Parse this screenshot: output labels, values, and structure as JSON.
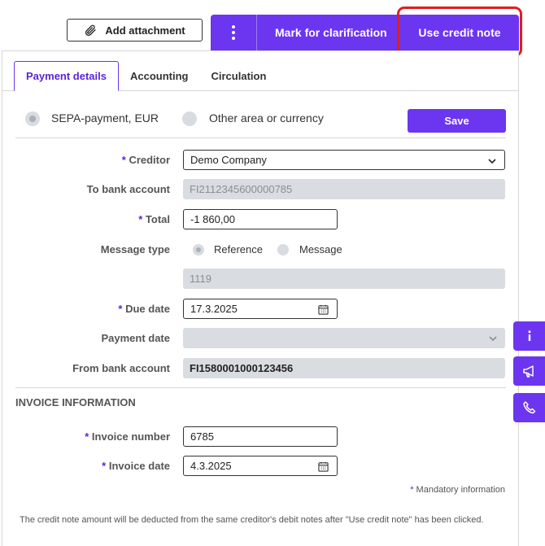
{
  "toolbar": {
    "add_attachment": "Add attachment",
    "mark_for_clarification": "Mark for clarification",
    "use_credit_note": "Use credit note"
  },
  "tabs": [
    {
      "label": "Payment details",
      "active": true
    },
    {
      "label": "Accounting",
      "active": false
    },
    {
      "label": "Circulation",
      "active": false
    }
  ],
  "payment_type": {
    "sepa_label": "SEPA-payment, EUR",
    "other_label": "Other area or currency",
    "selected": "sepa"
  },
  "save_label": "Save",
  "form": {
    "creditor": {
      "label": "Creditor",
      "value": "Demo Company",
      "required": "*"
    },
    "to_bank_account": {
      "label": "To bank account",
      "value": "FI2112345600000785"
    },
    "total": {
      "label": "Total",
      "value": "-1 860,00",
      "required": "*"
    },
    "message_type": {
      "label": "Message type",
      "option_reference": "Reference",
      "option_message": "Message",
      "selected": "reference"
    },
    "reference_value": "1119",
    "due_date": {
      "label": "Due date",
      "value": "17.3.2025",
      "required": "*"
    },
    "payment_date": {
      "label": "Payment date",
      "value": ""
    },
    "from_bank_account": {
      "label": "From bank account",
      "value": "FI1580001000123456"
    }
  },
  "invoice": {
    "section_title": "INVOICE INFORMATION",
    "invoice_number": {
      "label": "Invoice number",
      "value": "6785",
      "required": "*"
    },
    "invoice_date": {
      "label": "Invoice date",
      "value": "4.3.2025",
      "required": "*"
    }
  },
  "mandatory_note": {
    "star": "*",
    "text": "Mandatory information"
  },
  "footnote": "The credit note amount will be deducted from the same creditor's debit notes after \"Use credit note\" has been clicked.",
  "side_buttons": [
    "info-icon",
    "megaphone-icon",
    "phone-icon"
  ],
  "colors": {
    "accent": "#6c35f0",
    "highlight": "#e01e1e"
  }
}
